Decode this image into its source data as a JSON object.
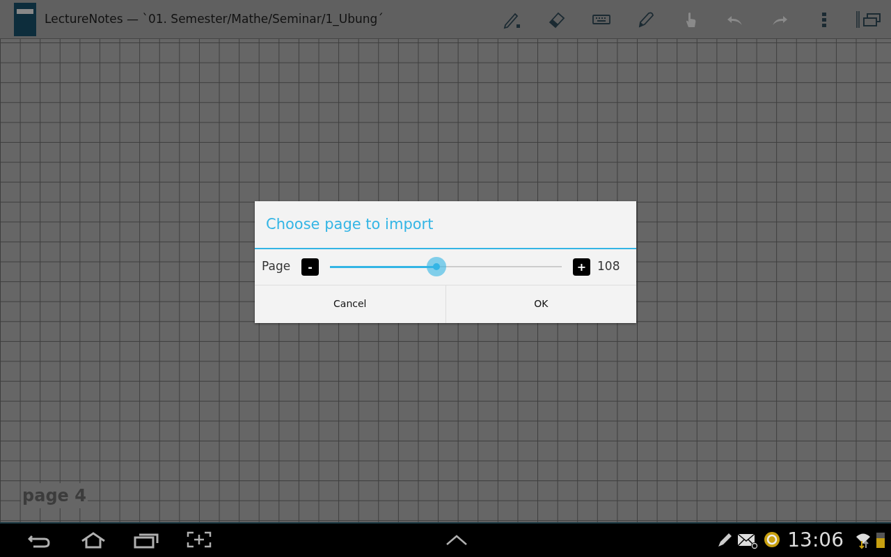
{
  "action_bar": {
    "title": "LectureNotes — `01. Semester/Mathe/Seminar/1_Ubung´"
  },
  "toolbar": [
    {
      "kind": "pen",
      "disabled": false
    },
    {
      "kind": "eraser",
      "disabled": false
    },
    {
      "kind": "keyboard",
      "disabled": false
    },
    {
      "kind": "highlighter",
      "disabled": false
    },
    {
      "kind": "hand",
      "disabled": true
    },
    {
      "kind": "undo",
      "disabled": true
    },
    {
      "kind": "redo",
      "disabled": true
    },
    {
      "kind": "overflow",
      "disabled": false
    },
    {
      "kind": "windows",
      "disabled": false
    }
  ],
  "canvas": {
    "page_label": "page 4"
  },
  "dialog": {
    "title": "Choose page to import",
    "label": "Page",
    "minus": "-",
    "plus": "+",
    "slider": {
      "level": 0.46
    },
    "value": "108",
    "buttons": [
      "Cancel",
      "OK"
    ]
  },
  "nav_bar": {
    "buttons": [
      {
        "kind": "back"
      },
      {
        "kind": "home"
      },
      {
        "kind": "recents"
      },
      {
        "kind": "screenshot"
      }
    ],
    "center": {
      "kind": "up"
    }
  },
  "status_bar": {
    "icons": [
      {
        "kind": "pencil"
      },
      {
        "kind": "mail"
      },
      {
        "kind": "sync"
      }
    ],
    "time": "13:06",
    "trailing": [
      {
        "kind": "wifi"
      },
      {
        "kind": "battery"
      }
    ]
  }
}
